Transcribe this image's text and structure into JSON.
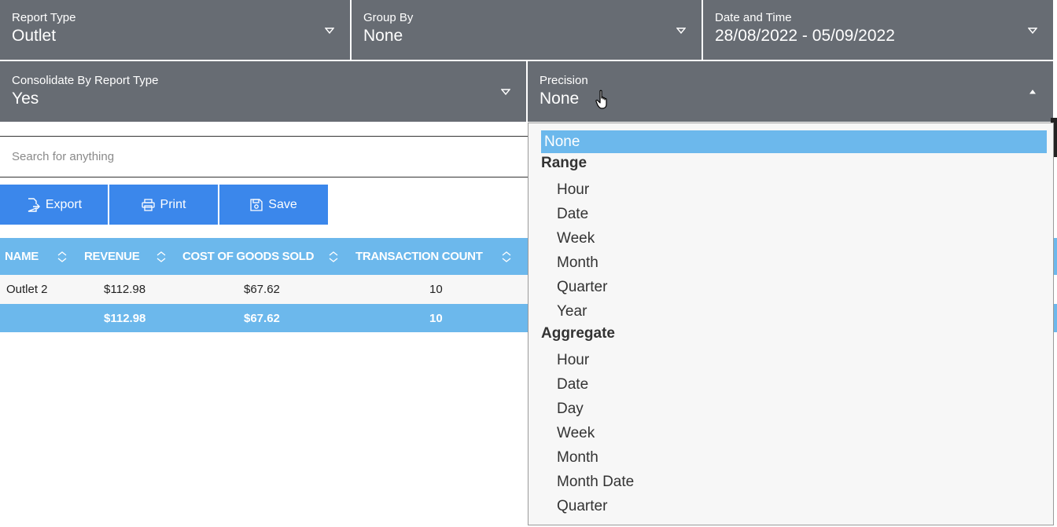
{
  "filters": {
    "report_type": {
      "label": "Report Type",
      "value": "Outlet"
    },
    "group_by": {
      "label": "Group By",
      "value": "None"
    },
    "date_time": {
      "label": "Date and Time",
      "value": "28/08/2022 - 05/09/2022"
    },
    "consolidate": {
      "label": "Consolidate By Report Type",
      "value": "Yes"
    },
    "precision": {
      "label": "Precision",
      "value": "None"
    }
  },
  "search": {
    "placeholder": "Search for anything"
  },
  "actions": {
    "export": "Export",
    "print": "Print",
    "save": "Save"
  },
  "table": {
    "columns": [
      "NAME",
      "REVENUE",
      "COST OF GOODS SOLD",
      "TRANSACTION COUNT"
    ],
    "rows": [
      {
        "name": "Outlet 2",
        "revenue": "$112.98",
        "cogs": "$67.62",
        "count": "10"
      }
    ],
    "totals": {
      "name": "",
      "revenue": "$112.98",
      "cogs": "$67.62",
      "count": "10"
    }
  },
  "precision_dropdown": {
    "selected": "None",
    "groups": [
      {
        "label": "Range",
        "items": [
          "Hour",
          "Date",
          "Week",
          "Month",
          "Quarter",
          "Year"
        ]
      },
      {
        "label": "Aggregate",
        "items": [
          "Hour",
          "Date",
          "Day",
          "Week",
          "Month",
          "Month Date",
          "Quarter"
        ]
      }
    ]
  },
  "colors": {
    "filter_bg": "#676c73",
    "button_bg": "#3b87eb",
    "table_header_bg": "#6cb8ec",
    "selected_option_bg": "#6cb8ec"
  },
  "icons": {
    "caret_down": "caret-down-icon",
    "caret_up": "caret-up-icon",
    "sort": "sort-icon",
    "export": "file-export-icon",
    "print": "printer-icon",
    "save": "floppy-disk-icon",
    "cursor": "hand-pointer-icon"
  }
}
